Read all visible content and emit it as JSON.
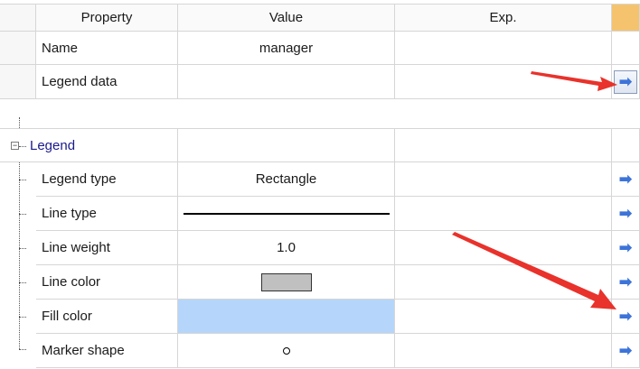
{
  "top_table": {
    "headers": {
      "property": "Property",
      "value": "Value",
      "exp": "Exp."
    },
    "rows": [
      {
        "property": "Name",
        "value": "manager",
        "exp": ""
      },
      {
        "property": "Legend data",
        "value": "",
        "exp": ""
      }
    ],
    "header_accent_color": "#f5c36e"
  },
  "legend_table": {
    "group_label": "Legend",
    "expander_symbol": "−",
    "rows": [
      {
        "property": "Legend type",
        "value": "Rectangle",
        "exp": ""
      },
      {
        "property": "Line type",
        "value": "",
        "exp": ""
      },
      {
        "property": "Line weight",
        "value": "1.0",
        "exp": ""
      },
      {
        "property": "Line color",
        "value": "",
        "exp": "",
        "swatch_color": "#c0c0c0"
      },
      {
        "property": "Fill color",
        "value": "",
        "exp": "",
        "selected_color": "#b5d6fa"
      },
      {
        "property": "Marker shape",
        "value": "",
        "exp": ""
      }
    ]
  },
  "icons": {
    "go_arrow": "arrow-right-icon",
    "arrow_glyph": "➡"
  },
  "annotation_color": "#e8322b"
}
